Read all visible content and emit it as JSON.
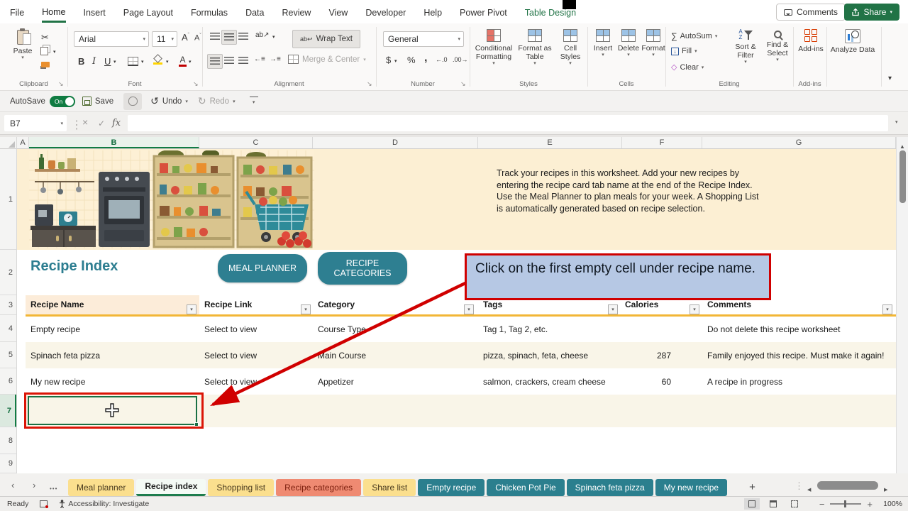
{
  "titlebar": {
    "comments": "Comments",
    "share": "Share"
  },
  "menu": {
    "tabs": [
      "File",
      "Home",
      "Insert",
      "Page Layout",
      "Formulas",
      "Data",
      "Review",
      "View",
      "Developer",
      "Help",
      "Power Pivot",
      "Table Design"
    ]
  },
  "ribbon": {
    "clipboard": {
      "label": "Clipboard",
      "paste": "Paste"
    },
    "font": {
      "label": "Font",
      "name": "Arial",
      "size": "11"
    },
    "alignment": {
      "label": "Alignment",
      "wrap": "Wrap Text",
      "merge": "Merge & Center"
    },
    "number": {
      "label": "Number",
      "format": "General"
    },
    "styles": {
      "label": "Styles",
      "conditional": "Conditional Formatting",
      "format_table": "Format as Table",
      "cell_styles": "Cell Styles"
    },
    "cells": {
      "label": "Cells",
      "insert": "Insert",
      "delete": "Delete",
      "format": "Format"
    },
    "editing": {
      "label": "Editing",
      "autosum": "AutoSum",
      "fill": "Fill",
      "clear": "Clear",
      "sort": "Sort & Filter",
      "find": "Find & Select"
    },
    "addins": {
      "label": "Add-ins",
      "addins": "Add-ins",
      "analyze": "Analyze Data"
    }
  },
  "qat": {
    "autosave": "AutoSave",
    "autosave_state": "On",
    "save": "Save",
    "undo": "Undo",
    "redo": "Redo"
  },
  "formula_bar": {
    "cell_ref": "B7",
    "formula": ""
  },
  "sheet": {
    "columns": [
      "A",
      "B",
      "C",
      "D",
      "E",
      "F",
      "G"
    ],
    "rows": [
      "1",
      "2",
      "3",
      "4",
      "5",
      "6",
      "7",
      "8",
      "9"
    ],
    "intro": "Track your recipes in this worksheet. Add your new recipes by entering the recipe card tab name at the end of the Recipe Index. Use the Meal Planner to plan meals for your week. A Shopping List is automatically generated based on recipe selection.",
    "title": "Recipe Index",
    "meal_planner": "MEAL PLANNER",
    "recipe_categories": "RECIPE CATEGORIES",
    "table": {
      "headers": [
        "Recipe Name",
        "Recipe Link",
        "Category",
        "Tags",
        "Calories",
        "Comments"
      ],
      "rows": [
        [
          "Empty recipe",
          "Select to view",
          "Course Type",
          "Tag 1, Tag 2, etc.",
          "",
          "Do not delete this recipe worksheet"
        ],
        [
          "Spinach feta pizza",
          "Select to view",
          "Main Course",
          "pizza, spinach, feta, cheese",
          "287",
          "Family enjoyed this recipe. Must make it again!"
        ],
        [
          "My new recipe",
          "Select to view",
          "Appetizer",
          "salmon, crackers, cream cheese",
          "60",
          "A recipe in progress"
        ]
      ]
    }
  },
  "annotation": {
    "callout": "Click on the first empty cell under recipe name."
  },
  "sheet_tabs": {
    "items": [
      "Meal planner",
      "Recipe index",
      "Shopping list",
      "Recipe categories",
      "Share list",
      "Empty recipe",
      "Chicken Pot Pie",
      "Spinach feta pizza",
      "My new recipe"
    ],
    "active": "Recipe index"
  },
  "status": {
    "ready": "Ready",
    "accessibility": "Accessibility: Investigate",
    "zoom": "100%"
  },
  "colors": {
    "excel_green": "#217346",
    "teal": "#2e7f8f",
    "tab_yellow": "#fbdf8e",
    "tab_red": "#ef8a72",
    "header_gold": "#f2b636",
    "callout_blue": "#b6c8e4",
    "annotation_red": "#d00000",
    "selection_green": "#1a7044",
    "band_cream": "#f9f5e8",
    "sheet_cream": "#fcefd3"
  }
}
